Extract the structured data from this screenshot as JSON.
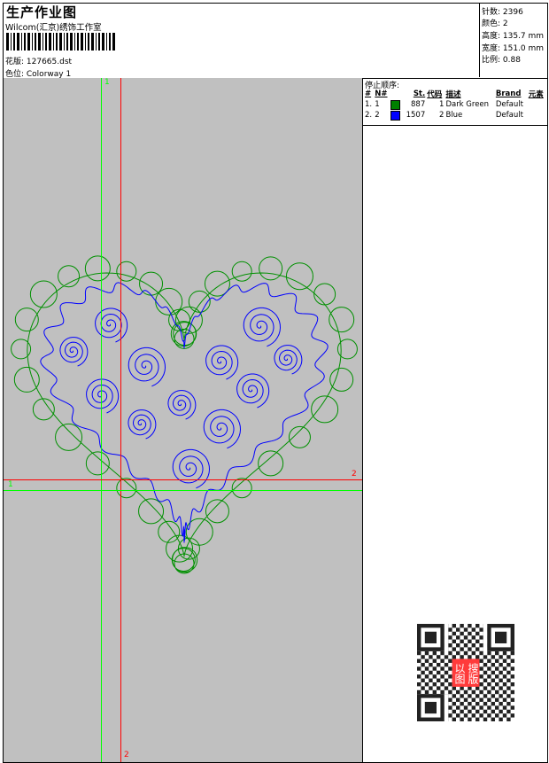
{
  "header": {
    "title": "生产作业图",
    "company": "Wilcom(汇京)绣饰工作室",
    "design": "花版: 127665.dst",
    "colorway": "色位: Colorway 1"
  },
  "stats": {
    "stitches": "针数: 2396",
    "colors": "颜色: 2",
    "height": "高度: 135.7 mm",
    "width": "宽度: 151.0 mm",
    "scale": "比例: 0.88"
  },
  "stop_sequence": {
    "title": "停止顺序:",
    "columns": [
      "#",
      "N#",
      "",
      "St.",
      "代码",
      "描述",
      "Brand",
      "元素"
    ],
    "rows": [
      {
        "idx": "1.",
        "n": "1",
        "color": "#008000",
        "st": "887",
        "code": "1",
        "desc": "Dark Green",
        "brand": "Default"
      },
      {
        "idx": "2.",
        "n": "2",
        "color": "#0000ff",
        "st": "1507",
        "code": "2",
        "desc": "Blue",
        "brand": "Default"
      }
    ]
  },
  "canvas": {
    "background": "#c0c0c0",
    "marker_1": "1",
    "marker_2": "2",
    "green": "#00ff00",
    "red": "#ff0000"
  },
  "qr": {
    "badge": "以图搜版"
  }
}
